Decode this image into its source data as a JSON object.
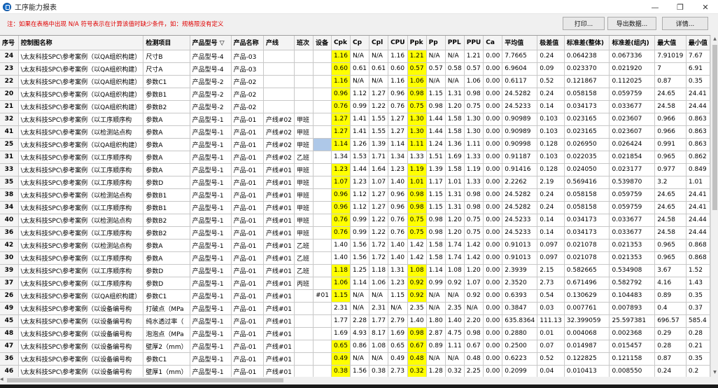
{
  "window": {
    "title": "工序能力报表",
    "controls": [
      "—",
      "❐",
      "✕"
    ]
  },
  "toolbar": {
    "note": "注：如果在表格中出现 N/A 符号表示在计算该值时缺少条件，如：规格限没有定义",
    "print_label": "打印...",
    "export_label": "导出数据...",
    "detail_label": "详情..."
  },
  "colors": {
    "highlight": "#ffff00",
    "selected": "#aec8e8",
    "note": "#e00000"
  },
  "table": {
    "headers": [
      "序号",
      "控制图名称",
      "检测项目",
      "产品型号 ▽",
      "产品名称",
      "产线",
      "班次",
      "设备",
      "Cpk",
      "Cp",
      "Cpl",
      "CPU",
      "Ppk",
      "Pp",
      "PPL",
      "PPU",
      "Ca",
      "平均值",
      "极差值",
      "标准差(整体)",
      "标准差(组内)",
      "最大值",
      "最小值"
    ],
    "rows": [
      [
        "24",
        "\\太友科技SPC\\参考案例（以QA组织构建）",
        "尺寸B",
        "产品型号-4",
        "产品-03",
        "",
        "",
        "",
        "1.16",
        "N/A",
        "N/A",
        "1.16",
        "1.21",
        "N/A",
        "N/A",
        "1.21",
        "0.00",
        "7.7665",
        "0.24",
        "0.064238",
        "0.067336",
        "7.91019",
        "7.67"
      ],
      [
        "23",
        "\\太友科技SPC\\参考案例（以QA组织构建）",
        "尺寸A",
        "产品型号-4",
        "产品-03",
        "",
        "",
        "",
        "0.60",
        "0.61",
        "0.61",
        "0.60",
        "0.57",
        "0.57",
        "0.58",
        "0.57",
        "0.00",
        "6.9604",
        "0.09",
        "0.023370",
        "0.021920",
        "7",
        "6.91"
      ],
      [
        "22",
        "\\太友科技SPC\\参考案例（以QA组织构建）",
        "参数C1",
        "产品型号-2",
        "产品-02",
        "",
        "",
        "",
        "1.16",
        "N/A",
        "N/A",
        "1.16",
        "1.06",
        "N/A",
        "N/A",
        "1.06",
        "0.00",
        "0.6117",
        "0.52",
        "0.121867",
        "0.112025",
        "0.87",
        "0.35"
      ],
      [
        "20",
        "\\太友科技SPC\\参考案例（以QA组织构建）",
        "参数B1",
        "产品型号-2",
        "产品-02",
        "",
        "",
        "",
        "0.96",
        "1.12",
        "1.27",
        "0.96",
        "0.98",
        "1.15",
        "1.31",
        "0.98",
        "0.00",
        "24.5282",
        "0.24",
        "0.058158",
        "0.059759",
        "24.65",
        "24.41"
      ],
      [
        "21",
        "\\太友科技SPC\\参考案例（以QA组织构建）",
        "参数B2",
        "产品型号-2",
        "产品-02",
        "",
        "",
        "",
        "0.76",
        "0.99",
        "1.22",
        "0.76",
        "0.75",
        "0.98",
        "1.20",
        "0.75",
        "0.00",
        "24.5233",
        "0.14",
        "0.034173",
        "0.033677",
        "24.58",
        "24.44"
      ],
      [
        "32",
        "\\太友科技SPC\\参考案例（以工序顺序构",
        "参数A",
        "产品型号-1",
        "产品-01",
        "产线#02",
        "甲班",
        "",
        "1.27",
        "1.41",
        "1.55",
        "1.27",
        "1.30",
        "1.44",
        "1.58",
        "1.30",
        "0.00",
        "0.90989",
        "0.103",
        "0.023165",
        "0.023607",
        "0.966",
        "0.863"
      ],
      [
        "41",
        "\\太友科技SPC\\参考案例（以检测站点构",
        "参数A",
        "产品型号-1",
        "产品-01",
        "产线#02",
        "甲班",
        "",
        "1.27",
        "1.41",
        "1.55",
        "1.27",
        "1.30",
        "1.44",
        "1.58",
        "1.30",
        "0.00",
        "0.90989",
        "0.103",
        "0.023165",
        "0.023607",
        "0.966",
        "0.863"
      ],
      [
        "25",
        "\\太友科技SPC\\参考案例（以QA组织构建）",
        "参数A",
        "产品型号-1",
        "产品-01",
        "产线#02",
        "甲班",
        "",
        "1.14",
        "1.26",
        "1.39",
        "1.14",
        "1.11",
        "1.24",
        "1.36",
        "1.11",
        "0.00",
        "0.90998",
        "0.128",
        "0.026950",
        "0.026424",
        "0.991",
        "0.863"
      ],
      [
        "31",
        "\\太友科技SPC\\参考案例（以工序顺序构",
        "参数A",
        "产品型号-1",
        "产品-01",
        "产线#02",
        "乙班",
        "",
        "1.34",
        "1.53",
        "1.71",
        "1.34",
        "1.33",
        "1.51",
        "1.69",
        "1.33",
        "0.00",
        "0.91187",
        "0.103",
        "0.022035",
        "0.021854",
        "0.965",
        "0.862"
      ],
      [
        "33",
        "\\太友科技SPC\\参考案例（以工序顺序构",
        "参数A",
        "产品型号-1",
        "产品-01",
        "产线#01",
        "甲班",
        "",
        "1.23",
        "1.44",
        "1.64",
        "1.23",
        "1.19",
        "1.39",
        "1.58",
        "1.19",
        "0.00",
        "0.91416",
        "0.128",
        "0.024050",
        "0.023177",
        "0.977",
        "0.849"
      ],
      [
        "35",
        "\\太友科技SPC\\参考案例（以工序顺序构",
        "参数D",
        "产品型号-1",
        "产品-01",
        "产线#01",
        "甲班",
        "",
        "1.07",
        "1.23",
        "1.07",
        "1.40",
        "1.01",
        "1.17",
        "1.01",
        "1.33",
        "0.00",
        "2.2262",
        "2.19",
        "0.569416",
        "0.539870",
        "3.2",
        "1.01"
      ],
      [
        "38",
        "\\太友科技SPC\\参考案例（以检测站点构",
        "参数B1",
        "产品型号-1",
        "产品-01",
        "产线#01",
        "甲班",
        "",
        "0.96",
        "1.12",
        "1.27",
        "0.96",
        "0.98",
        "1.15",
        "1.31",
        "0.98",
        "0.00",
        "24.5282",
        "0.24",
        "0.058158",
        "0.059759",
        "24.65",
        "24.41"
      ],
      [
        "34",
        "\\太友科技SPC\\参考案例（以工序顺序构",
        "参数B1",
        "产品型号-1",
        "产品-01",
        "产线#01",
        "甲班",
        "",
        "0.96",
        "1.12",
        "1.27",
        "0.96",
        "0.98",
        "1.15",
        "1.31",
        "0.98",
        "0.00",
        "24.5282",
        "0.24",
        "0.058158",
        "0.059759",
        "24.65",
        "24.41"
      ],
      [
        "40",
        "\\太友科技SPC\\参考案例（以检测站点构",
        "参数B2",
        "产品型号-1",
        "产品-01",
        "产线#01",
        "甲班",
        "",
        "0.76",
        "0.99",
        "1.22",
        "0.76",
        "0.75",
        "0.98",
        "1.20",
        "0.75",
        "0.00",
        "24.5233",
        "0.14",
        "0.034173",
        "0.033677",
        "24.58",
        "24.44"
      ],
      [
        "36",
        "\\太友科技SPC\\参考案例（以工序顺序构",
        "参数B2",
        "产品型号-1",
        "产品-01",
        "产线#01",
        "甲班",
        "",
        "0.76",
        "0.99",
        "1.22",
        "0.76",
        "0.75",
        "0.98",
        "1.20",
        "0.75",
        "0.00",
        "24.5233",
        "0.14",
        "0.034173",
        "0.033677",
        "24.58",
        "24.44"
      ],
      [
        "42",
        "\\太友科技SPC\\参考案例（以检测站点构",
        "参数A",
        "产品型号-1",
        "产品-01",
        "产线#01",
        "乙班",
        "",
        "1.40",
        "1.56",
        "1.72",
        "1.40",
        "1.42",
        "1.58",
        "1.74",
        "1.42",
        "0.00",
        "0.91013",
        "0.097",
        "0.021078",
        "0.021353",
        "0.965",
        "0.868"
      ],
      [
        "30",
        "\\太友科技SPC\\参考案例（以工序顺序构",
        "参数A",
        "产品型号-1",
        "产品-01",
        "产线#01",
        "乙班",
        "",
        "1.40",
        "1.56",
        "1.72",
        "1.40",
        "1.42",
        "1.58",
        "1.74",
        "1.42",
        "0.00",
        "0.91013",
        "0.097",
        "0.021078",
        "0.021353",
        "0.965",
        "0.868"
      ],
      [
        "39",
        "\\太友科技SPC\\参考案例（以工序顺序构",
        "参数D",
        "产品型号-1",
        "产品-01",
        "产线#01",
        "乙班",
        "",
        "1.18",
        "1.25",
        "1.18",
        "1.31",
        "1.08",
        "1.14",
        "1.08",
        "1.20",
        "0.00",
        "2.3939",
        "2.15",
        "0.582665",
        "0.534908",
        "3.67",
        "1.52"
      ],
      [
        "37",
        "\\太友科技SPC\\参考案例（以工序顺序构",
        "参数D",
        "产品型号-1",
        "产品-01",
        "产线#01",
        "丙班",
        "",
        "1.06",
        "1.14",
        "1.06",
        "1.23",
        "0.92",
        "0.99",
        "0.92",
        "1.07",
        "0.00",
        "2.3520",
        "2.73",
        "0.671496",
        "0.582792",
        "4.16",
        "1.43"
      ],
      [
        "26",
        "\\太友科技SPC\\参考案例（以QA组织构建）",
        "参数C1",
        "产品型号-1",
        "产品-01",
        "产线#01",
        "",
        "#01",
        "1.15",
        "N/A",
        "N/A",
        "1.15",
        "0.92",
        "N/A",
        "N/A",
        "0.92",
        "0.00",
        "0.6393",
        "0.54",
        "0.130629",
        "0.104483",
        "0.89",
        "0.35"
      ],
      [
        "49",
        "\\太友科技SPC\\参考案例（以设备编号构",
        "打破点（MPa",
        "产品型号-1",
        "产品-01",
        "产线#01",
        "",
        "",
        "2.31",
        "N/A",
        "2.31",
        "N/A",
        "2.35",
        "N/A",
        "2.35",
        "N/A",
        "0.00",
        "0.3847",
        "0.03",
        "0.007761",
        "0.007893",
        "0.4",
        "0.37"
      ],
      [
        "45",
        "\\太友科技SPC\\参考案例（以设备编号构",
        "纯水透过率（",
        "产品型号-1",
        "产品-01",
        "产线#01",
        "",
        "",
        "1.77",
        "2.28",
        "1.77",
        "2.79",
        "1.40",
        "1.80",
        "1.40",
        "2.20",
        "0.00",
        "635.8364",
        "111.13",
        "32.399059",
        "25.597381",
        "696.57",
        "585.4"
      ],
      [
        "48",
        "\\太友科技SPC\\参考案例（以设备编号构",
        "泡泡点（MPa",
        "产品型号-1",
        "产品-01",
        "产线#01",
        "",
        "",
        "1.69",
        "4.93",
        "8.17",
        "1.69",
        "0.98",
        "2.87",
        "4.75",
        "0.98",
        "0.00",
        "0.2880",
        "0.01",
        "0.004068",
        "0.002368",
        "0.29",
        "0.28"
      ],
      [
        "47",
        "\\太友科技SPC\\参考案例（以设备编号构",
        "壁厚2（mm）",
        "产品型号-1",
        "产品-01",
        "产线#01",
        "",
        "",
        "0.65",
        "0.86",
        "1.08",
        "0.65",
        "0.67",
        "0.89",
        "1.11",
        "0.67",
        "0.00",
        "0.2500",
        "0.07",
        "0.014987",
        "0.015457",
        "0.28",
        "0.21"
      ],
      [
        "36",
        "\\太友科技SPC\\参考案例（以设备编号构",
        "参数C1",
        "产品型号-1",
        "产品-01",
        "产线#01",
        "",
        "",
        "0.49",
        "N/A",
        "N/A",
        "0.49",
        "0.48",
        "N/A",
        "N/A",
        "0.48",
        "0.00",
        "0.6223",
        "0.52",
        "0.122825",
        "0.121158",
        "0.87",
        "0.35"
      ],
      [
        "46",
        "\\太友科技SPC\\参考案例（以设备编号构",
        "壁厚1（mm）",
        "产品型号-1",
        "产品-01",
        "产线#01",
        "",
        "",
        "0.38",
        "1.56",
        "0.38",
        "2.73",
        "0.32",
        "1.28",
        "0.32",
        "2.25",
        "0.00",
        "0.2099",
        "0.04",
        "0.010413",
        "0.008550",
        "0.24",
        "0.2"
      ]
    ],
    "highlighted": {
      "cpk_rows": [
        0,
        1,
        2,
        3,
        4,
        5,
        6,
        7,
        9,
        10,
        11,
        12,
        13,
        14,
        17,
        18,
        19,
        23,
        24,
        25
      ],
      "ppk_rows": [
        0,
        1,
        2,
        3,
        4,
        5,
        6,
        7,
        9,
        10,
        11,
        12,
        13,
        14,
        17,
        18,
        19,
        22,
        23,
        24,
        25
      ]
    },
    "selected_cell": {
      "row": 7,
      "col": 7
    }
  }
}
